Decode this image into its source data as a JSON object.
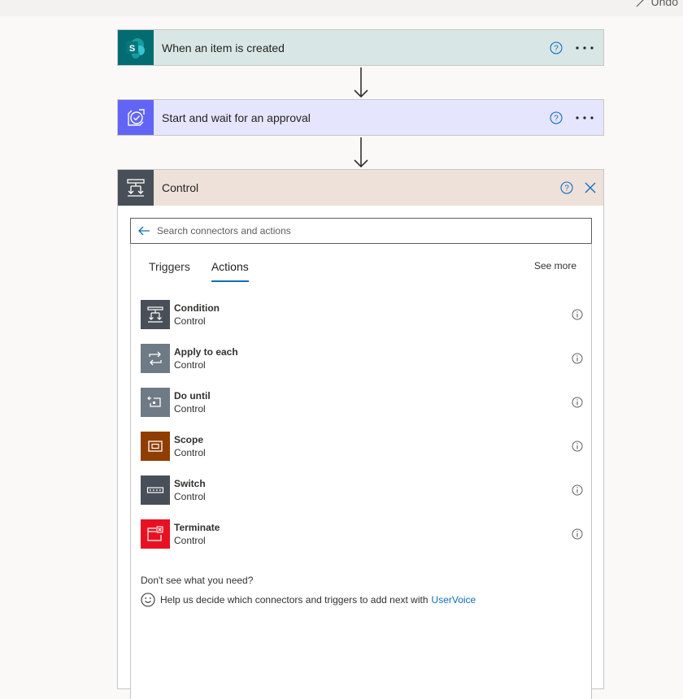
{
  "topbar": {
    "undo_label": "Undo"
  },
  "colors": {
    "sharepoint": "#036c70",
    "approval": "#6264f5",
    "control": "#484f58",
    "scope": "#8f3e00",
    "terminate": "#e81123",
    "link": "#0f6cbd"
  },
  "flow": {
    "trigger": {
      "title": "When an item is created",
      "icon": "sharepoint-icon"
    },
    "approval": {
      "title": "Start and wait for an approval",
      "icon": "approval-icon"
    },
    "control": {
      "title": "Control",
      "icon": "control-icon"
    }
  },
  "picker": {
    "search_placeholder": "Search connectors and actions",
    "tabs": [
      "Triggers",
      "Actions"
    ],
    "active_tab": "Actions",
    "see_more": "See more",
    "actions": [
      {
        "name": "Condition",
        "connector": "Control",
        "icon": "condition-icon"
      },
      {
        "name": "Apply to each",
        "connector": "Control",
        "icon": "apply-to-each-icon"
      },
      {
        "name": "Do until",
        "connector": "Control",
        "icon": "do-until-icon"
      },
      {
        "name": "Scope",
        "connector": "Control",
        "icon": "scope-icon"
      },
      {
        "name": "Switch",
        "connector": "Control",
        "icon": "switch-icon"
      },
      {
        "name": "Terminate",
        "connector": "Control",
        "icon": "terminate-icon"
      }
    ],
    "dont_see": "Don't see what you need?",
    "help_text": "Help us decide which connectors and triggers to add next with",
    "help_link": "UserVoice"
  }
}
